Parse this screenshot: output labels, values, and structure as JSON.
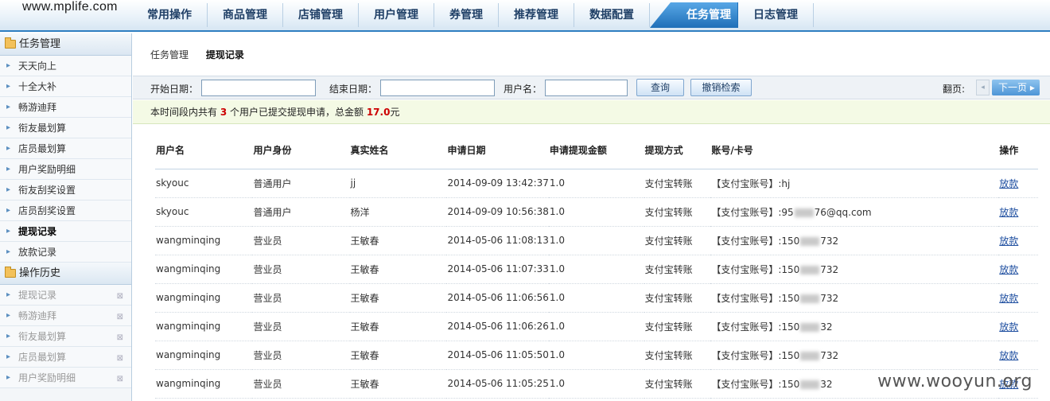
{
  "logo": "www.mplife.com",
  "nav": {
    "items": [
      "常用操作",
      "商品管理",
      "店铺管理",
      "用户管理",
      "券管理",
      "推荐管理",
      "数据配置",
      "任务管理",
      "日志管理"
    ],
    "active_index": 7
  },
  "sidebar": {
    "section1_title": "任务管理",
    "items": [
      "天天向上",
      "十全大补",
      "畅游迪拜",
      "衔友最划算",
      "店员最划算",
      "用户奖励明细",
      "衔友刮奖设置",
      "店员刮奖设置",
      "提现记录",
      "放款记录"
    ],
    "active_index": 8,
    "section2_title": "操作历史",
    "history": [
      "提现记录",
      "畅游迪拜",
      "衔友最划算",
      "店员最划算",
      "用户奖励明细"
    ],
    "close_glyph": "⊠"
  },
  "breadcrumb": {
    "parent": "任务管理",
    "current": "提现记录"
  },
  "search": {
    "start_label": "开始日期：",
    "end_label": "结束日期：",
    "user_label": "用户名：",
    "start_value": "",
    "end_value": "",
    "user_value": "",
    "query_button": "查询",
    "cancel_button": "撤销检索",
    "page_label": "翻页:",
    "prev_glyph": "◂",
    "next_button": "下一页 ▸"
  },
  "summary": {
    "prefix": "本时间段内共有 ",
    "user_count": "3",
    "middle": " 个用户已提交提现申请，总金额 ",
    "total": "17.0",
    "suffix": "元"
  },
  "table": {
    "headers": [
      "用户名",
      "用户身份",
      "真实姓名",
      "申请日期",
      "申请提现金额",
      "提现方式",
      "账号/卡号",
      "操作"
    ],
    "rows": [
      {
        "user": "skyouc",
        "role": "普通用户",
        "name": "jj",
        "date": "2014-09-09 13:42:37",
        "amount": "1.0",
        "method": "支付宝转账",
        "acc_a": "【支付宝账号】:hj",
        "acc_b": "",
        "blurred": false,
        "action": "放款"
      },
      {
        "user": "skyouc",
        "role": "普通用户",
        "name": "杨洋",
        "date": "2014-09-09 10:56:38",
        "amount": "1.0",
        "method": "支付宝转账",
        "acc_a": "【支付宝账号】:95",
        "acc_b": "76@qq.com",
        "blurred": true,
        "action": "放款"
      },
      {
        "user": "wangminqing",
        "role": "营业员",
        "name": "王敏春",
        "date": "2014-05-06 11:08:13",
        "amount": "1.0",
        "method": "支付宝转账",
        "acc_a": "【支付宝账号】:150",
        "acc_b": "732",
        "blurred": true,
        "action": "放款"
      },
      {
        "user": "wangminqing",
        "role": "营业员",
        "name": "王敏春",
        "date": "2014-05-06 11:07:33",
        "amount": "1.0",
        "method": "支付宝转账",
        "acc_a": "【支付宝账号】:150",
        "acc_b": "732",
        "blurred": true,
        "action": "放款"
      },
      {
        "user": "wangminqing",
        "role": "营业员",
        "name": "王敏春",
        "date": "2014-05-06 11:06:56",
        "amount": "1.0",
        "method": "支付宝转账",
        "acc_a": "【支付宝账号】:150",
        "acc_b": "732",
        "blurred": true,
        "action": "放款"
      },
      {
        "user": "wangminqing",
        "role": "营业员",
        "name": "王敏春",
        "date": "2014-05-06 11:06:26",
        "amount": "1.0",
        "method": "支付宝转账",
        "acc_a": "【支付宝账号】:150",
        "acc_b": "32",
        "blurred": true,
        "action": "放款"
      },
      {
        "user": "wangminqing",
        "role": "营业员",
        "name": "王敏春",
        "date": "2014-05-06 11:05:50",
        "amount": "1.0",
        "method": "支付宝转账",
        "acc_a": "【支付宝账号】:150",
        "acc_b": "732",
        "blurred": true,
        "action": "放款"
      },
      {
        "user": "wangminqing",
        "role": "营业员",
        "name": "王敏春",
        "date": "2014-05-06 11:05:25",
        "amount": "1.0",
        "method": "支付宝转账",
        "acc_a": "【支付宝账号】:150",
        "acc_b": "32",
        "blurred": true,
        "action": "放款"
      }
    ]
  },
  "watermark": "www.wooyun.org"
}
